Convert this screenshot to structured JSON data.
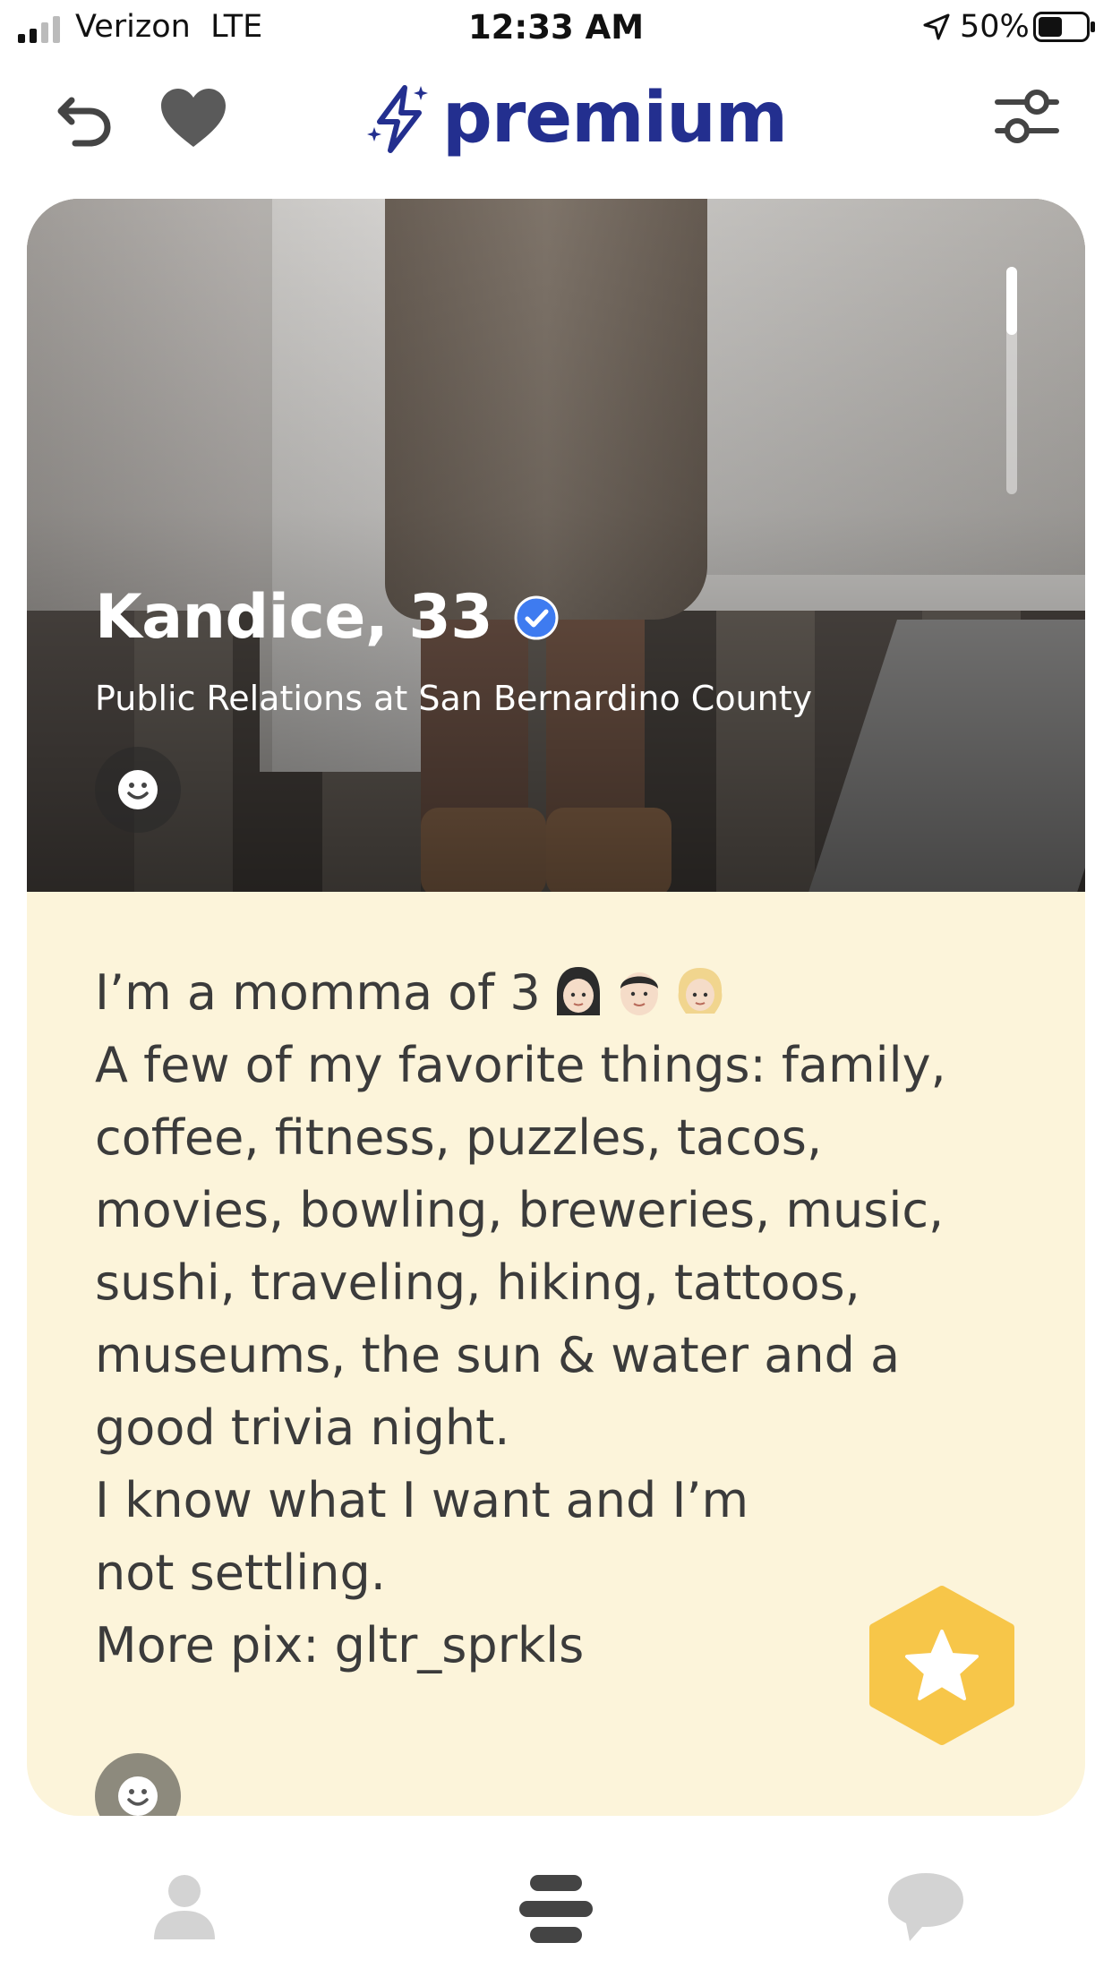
{
  "status_bar": {
    "carrier": "Verizon",
    "network": "LTE",
    "time": "12:33 AM",
    "battery": "50%",
    "battery_level": 0.5
  },
  "top_bar": {
    "brand": "premium",
    "icons": [
      "undo-icon",
      "heart-icon",
      "sparkle-bolt-icon",
      "filters-icon"
    ]
  },
  "profile": {
    "name_age": "Kandice, 33",
    "verified": true,
    "job": "Public Relations at San Bernardino County",
    "bio_lines": [
      "I’m a momma of 3",
      "A few of my favorite things: family,",
      "coffee, fitness, puzzles, tacos,",
      "movies, bowling, breweries, music,",
      "sushi, traveling, hiking, tattoos,",
      "museums, the sun & water and a",
      "good trivia night.",
      "I know what I want and I’m",
      "not settling.",
      "More pix: gltr_sprkls"
    ],
    "bio_emojis": [
      "woman-emoji",
      "boy-emoji",
      "blond-child-emoji"
    ]
  },
  "colors": {
    "brand": "#232f8f",
    "card_background": "#fcf4da",
    "star_fab": "#f7c649",
    "verified": "#3e7bf0",
    "nav_inactive": "#d3d3d3",
    "nav_active": "#444444"
  },
  "bottom_nav": {
    "items": [
      "profile-icon",
      "discover-icon",
      "chat-icon"
    ],
    "active": "discover-icon"
  }
}
